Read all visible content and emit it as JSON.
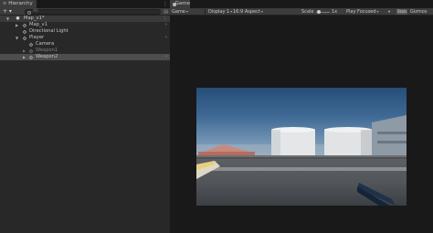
{
  "hierarchy": {
    "tab_label": "Hierarchy",
    "menu_icon": "kebab-menu-icon",
    "add_label": "+ ▾",
    "search_placeholder": "All",
    "tree": [
      {
        "label": "Map_v1*",
        "depth": 0,
        "type": "scene",
        "expanded": true
      },
      {
        "label": "Map_v1",
        "depth": 1,
        "type": "prefab",
        "expanded": false
      },
      {
        "label": "Directional Light",
        "depth": 1,
        "type": "object"
      },
      {
        "label": "Player",
        "depth": 1,
        "type": "prefab",
        "expanded": true
      },
      {
        "label": "Camera",
        "depth": 2,
        "type": "object"
      },
      {
        "label": "Weapon1",
        "depth": 2,
        "type": "prefab",
        "inactive": true
      },
      {
        "label": "Weapon2",
        "depth": 2,
        "type": "prefab",
        "selected": true
      }
    ]
  },
  "game": {
    "tab_label": "Game",
    "view_dropdown": "Game",
    "display_dropdown": "Display 1",
    "aspect_dropdown": "16:9 Aspect",
    "scale_label": "Scale",
    "scale_value": "1x",
    "play_mode_dropdown": "Play Focused",
    "stats_label": "Stats",
    "gizmos_label": "Gizmos",
    "scale_level": 0.05
  },
  "colors": {
    "panel": "#282828",
    "toolbar": "#3c3c3c",
    "selected_row": "#4d4d4d",
    "sky_top": "#264d78",
    "tank": "#e6e6e6"
  }
}
